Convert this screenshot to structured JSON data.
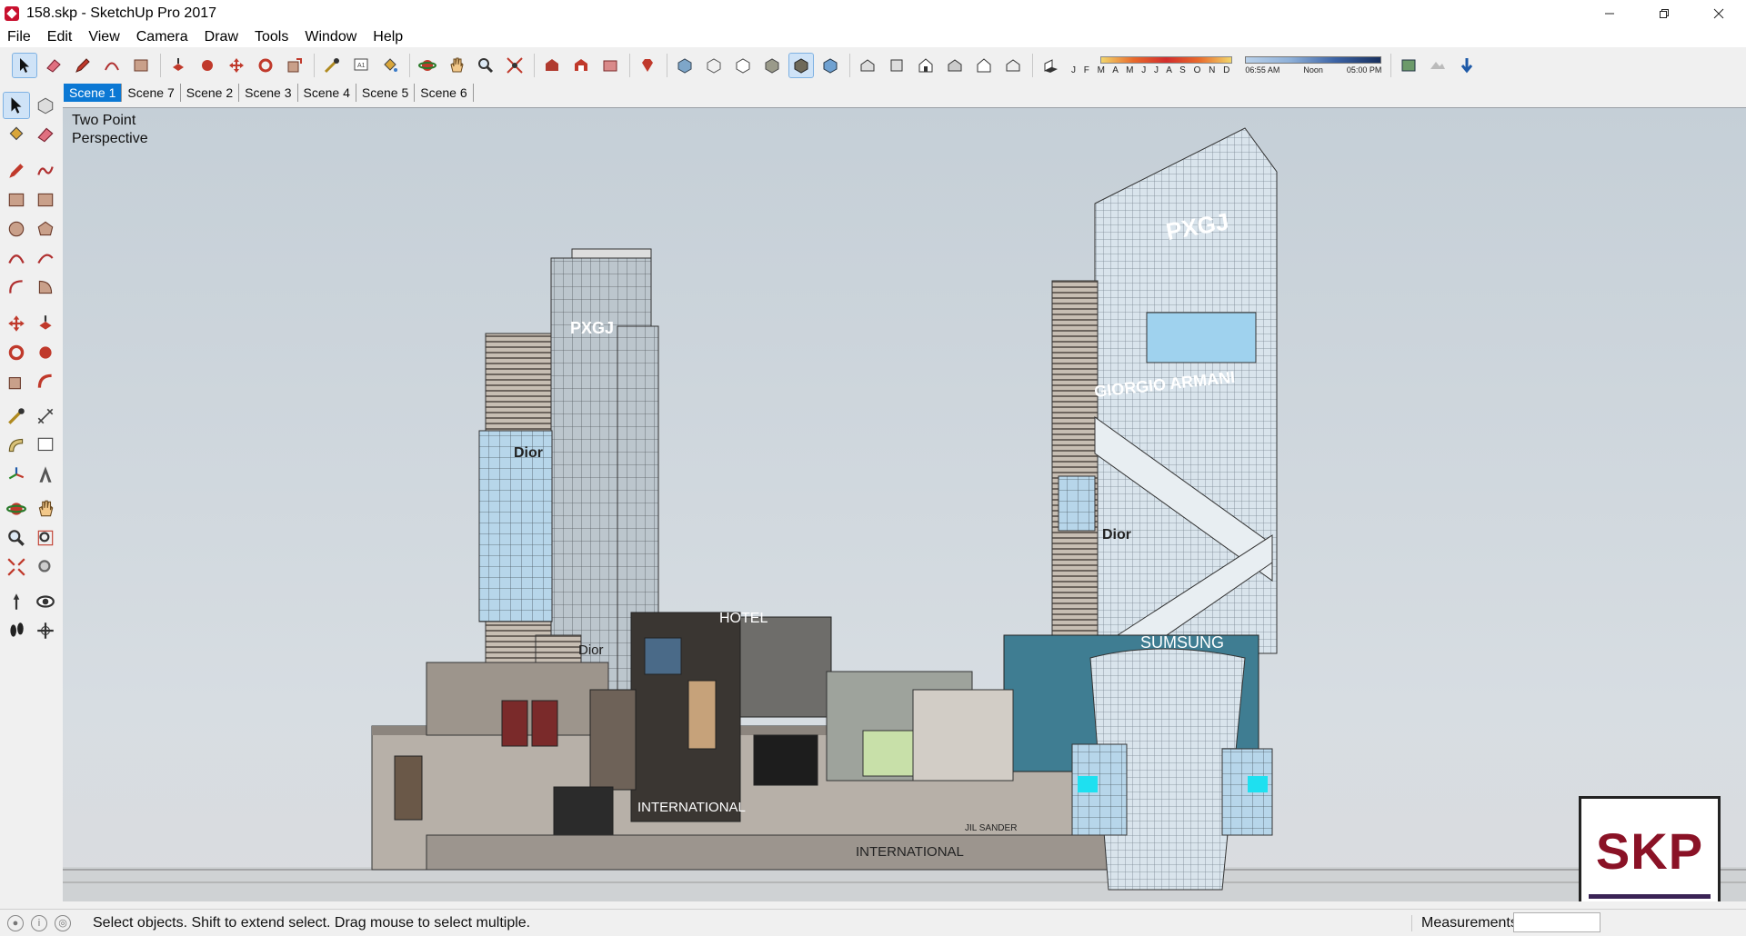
{
  "window": {
    "title": "158.skp - SketchUp Pro 2017",
    "controls": [
      "minimize-icon",
      "restore-icon",
      "close-icon"
    ]
  },
  "menu": [
    "File",
    "Edit",
    "View",
    "Camera",
    "Draw",
    "Tools",
    "Window",
    "Help"
  ],
  "toolbar": {
    "months": "J F M A M J J A S O N D",
    "time_start": "06:55 AM",
    "time_mid": "Noon",
    "time_end": "05:00 PM"
  },
  "scenes": [
    "Scene 1",
    "Scene 7",
    "Scene 2",
    "Scene 3",
    "Scene 4",
    "Scene 5",
    "Scene 6"
  ],
  "active_scene": "Scene 1",
  "viewport": {
    "camera_line1": "Two Point",
    "camera_line2": "Perspective",
    "logo": "SKP",
    "signs": {
      "pxgj": "PXGJ",
      "dior": "Dior",
      "armani": "GIORGIO ARMANI",
      "sumsung": "SUMSUNG",
      "hotel": "HOTEL",
      "international": "INTERNATIONAL",
      "jil_sander": "JIL SANDER"
    }
  },
  "status": {
    "message": "Select objects. Shift to extend select. Drag mouse to select multiple.",
    "measurements_label": "Measurements",
    "measurements_value": ""
  },
  "colors": {
    "accent": "#0b78d4",
    "logo_red": "#8a1226"
  }
}
